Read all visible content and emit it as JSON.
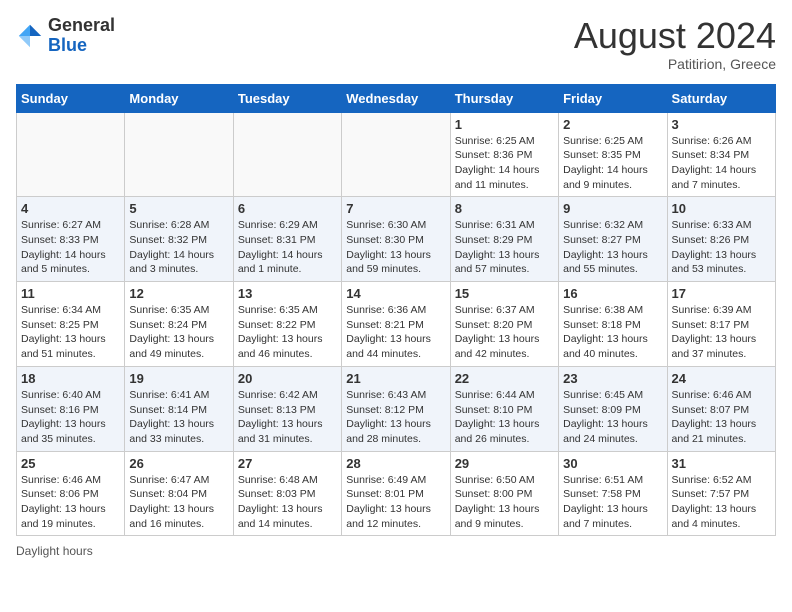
{
  "header": {
    "logo_general": "General",
    "logo_blue": "Blue",
    "month_year": "August 2024",
    "location": "Patitirion, Greece"
  },
  "footer": {
    "label": "Daylight hours"
  },
  "days_of_week": [
    "Sunday",
    "Monday",
    "Tuesday",
    "Wednesday",
    "Thursday",
    "Friday",
    "Saturday"
  ],
  "weeks": [
    [
      {
        "day": "",
        "info": ""
      },
      {
        "day": "",
        "info": ""
      },
      {
        "day": "",
        "info": ""
      },
      {
        "day": "",
        "info": ""
      },
      {
        "day": "1",
        "info": "Sunrise: 6:25 AM\nSunset: 8:36 PM\nDaylight: 14 hours and 11 minutes."
      },
      {
        "day": "2",
        "info": "Sunrise: 6:25 AM\nSunset: 8:35 PM\nDaylight: 14 hours and 9 minutes."
      },
      {
        "day": "3",
        "info": "Sunrise: 6:26 AM\nSunset: 8:34 PM\nDaylight: 14 hours and 7 minutes."
      }
    ],
    [
      {
        "day": "4",
        "info": "Sunrise: 6:27 AM\nSunset: 8:33 PM\nDaylight: 14 hours and 5 minutes."
      },
      {
        "day": "5",
        "info": "Sunrise: 6:28 AM\nSunset: 8:32 PM\nDaylight: 14 hours and 3 minutes."
      },
      {
        "day": "6",
        "info": "Sunrise: 6:29 AM\nSunset: 8:31 PM\nDaylight: 14 hours and 1 minute."
      },
      {
        "day": "7",
        "info": "Sunrise: 6:30 AM\nSunset: 8:30 PM\nDaylight: 13 hours and 59 minutes."
      },
      {
        "day": "8",
        "info": "Sunrise: 6:31 AM\nSunset: 8:29 PM\nDaylight: 13 hours and 57 minutes."
      },
      {
        "day": "9",
        "info": "Sunrise: 6:32 AM\nSunset: 8:27 PM\nDaylight: 13 hours and 55 minutes."
      },
      {
        "day": "10",
        "info": "Sunrise: 6:33 AM\nSunset: 8:26 PM\nDaylight: 13 hours and 53 minutes."
      }
    ],
    [
      {
        "day": "11",
        "info": "Sunrise: 6:34 AM\nSunset: 8:25 PM\nDaylight: 13 hours and 51 minutes."
      },
      {
        "day": "12",
        "info": "Sunrise: 6:35 AM\nSunset: 8:24 PM\nDaylight: 13 hours and 49 minutes."
      },
      {
        "day": "13",
        "info": "Sunrise: 6:35 AM\nSunset: 8:22 PM\nDaylight: 13 hours and 46 minutes."
      },
      {
        "day": "14",
        "info": "Sunrise: 6:36 AM\nSunset: 8:21 PM\nDaylight: 13 hours and 44 minutes."
      },
      {
        "day": "15",
        "info": "Sunrise: 6:37 AM\nSunset: 8:20 PM\nDaylight: 13 hours and 42 minutes."
      },
      {
        "day": "16",
        "info": "Sunrise: 6:38 AM\nSunset: 8:18 PM\nDaylight: 13 hours and 40 minutes."
      },
      {
        "day": "17",
        "info": "Sunrise: 6:39 AM\nSunset: 8:17 PM\nDaylight: 13 hours and 37 minutes."
      }
    ],
    [
      {
        "day": "18",
        "info": "Sunrise: 6:40 AM\nSunset: 8:16 PM\nDaylight: 13 hours and 35 minutes."
      },
      {
        "day": "19",
        "info": "Sunrise: 6:41 AM\nSunset: 8:14 PM\nDaylight: 13 hours and 33 minutes."
      },
      {
        "day": "20",
        "info": "Sunrise: 6:42 AM\nSunset: 8:13 PM\nDaylight: 13 hours and 31 minutes."
      },
      {
        "day": "21",
        "info": "Sunrise: 6:43 AM\nSunset: 8:12 PM\nDaylight: 13 hours and 28 minutes."
      },
      {
        "day": "22",
        "info": "Sunrise: 6:44 AM\nSunset: 8:10 PM\nDaylight: 13 hours and 26 minutes."
      },
      {
        "day": "23",
        "info": "Sunrise: 6:45 AM\nSunset: 8:09 PM\nDaylight: 13 hours and 24 minutes."
      },
      {
        "day": "24",
        "info": "Sunrise: 6:46 AM\nSunset: 8:07 PM\nDaylight: 13 hours and 21 minutes."
      }
    ],
    [
      {
        "day": "25",
        "info": "Sunrise: 6:46 AM\nSunset: 8:06 PM\nDaylight: 13 hours and 19 minutes."
      },
      {
        "day": "26",
        "info": "Sunrise: 6:47 AM\nSunset: 8:04 PM\nDaylight: 13 hours and 16 minutes."
      },
      {
        "day": "27",
        "info": "Sunrise: 6:48 AM\nSunset: 8:03 PM\nDaylight: 13 hours and 14 minutes."
      },
      {
        "day": "28",
        "info": "Sunrise: 6:49 AM\nSunset: 8:01 PM\nDaylight: 13 hours and 12 minutes."
      },
      {
        "day": "29",
        "info": "Sunrise: 6:50 AM\nSunset: 8:00 PM\nDaylight: 13 hours and 9 minutes."
      },
      {
        "day": "30",
        "info": "Sunrise: 6:51 AM\nSunset: 7:58 PM\nDaylight: 13 hours and 7 minutes."
      },
      {
        "day": "31",
        "info": "Sunrise: 6:52 AM\nSunset: 7:57 PM\nDaylight: 13 hours and 4 minutes."
      }
    ]
  ]
}
